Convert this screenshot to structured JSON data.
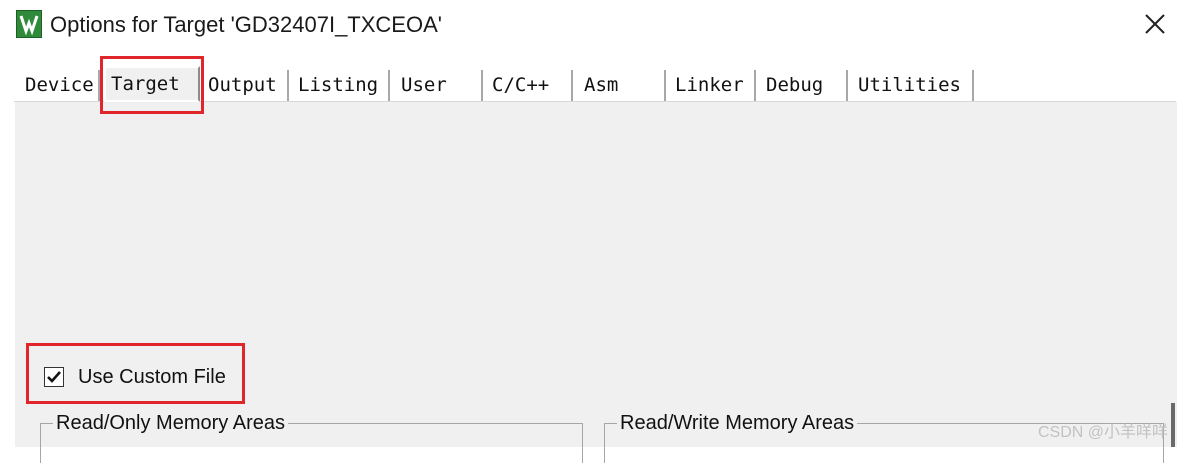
{
  "window": {
    "title": "Options for Target 'GD32407I_TXCEOA'",
    "app_icon": "keil-uvision-icon",
    "close_icon": "close-icon"
  },
  "tabs": [
    {
      "label": "Device",
      "active": false
    },
    {
      "label": "Target",
      "active": true
    },
    {
      "label": "Output",
      "active": false
    },
    {
      "label": "Listing",
      "active": false
    },
    {
      "label": "User",
      "active": false
    },
    {
      "label": "C/C++",
      "active": false
    },
    {
      "label": "Asm",
      "active": false
    },
    {
      "label": "Linker",
      "active": false
    },
    {
      "label": "Debug",
      "active": false
    },
    {
      "label": "Utilities",
      "active": false
    }
  ],
  "options": {
    "use_custom_file": {
      "label": "Use Custom File",
      "checked": true
    }
  },
  "groups": {
    "read_only": "Read/Only Memory Areas",
    "read_write": "Read/Write Memory Areas"
  },
  "highlight_color": "#e0262b",
  "watermark": "CSDN @小羊咩咩"
}
